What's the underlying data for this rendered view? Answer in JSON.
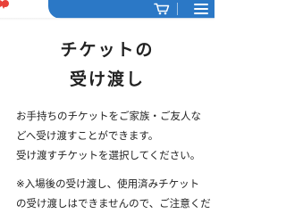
{
  "header": {
    "brand_color": "#e8413a",
    "bar_color": "#2b78c6",
    "cart_icon": "shopping-cart-icon",
    "menu_icon": "hamburger-menu-icon"
  },
  "title": {
    "line1": "チケットの",
    "line2": "受け渡し"
  },
  "content": {
    "line1": "お手持ちのチケットをご家族・ご友人な",
    "line2": "どへ受け渡すことができます。",
    "line3": "受け渡すチケットを選択してください。",
    "line4": "※入場後の受け渡し、使用済みチケット",
    "line5": "の受け渡しはできませんので、ご注意くだ"
  }
}
